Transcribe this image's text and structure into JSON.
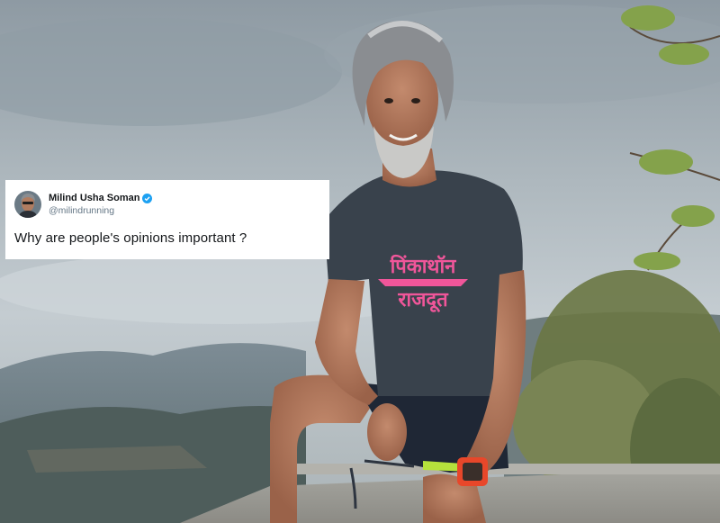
{
  "tweet": {
    "display_name": "Milind Usha Soman",
    "handle": "@milindrunning",
    "text": "Why are people's opinions important ?",
    "verified": true
  },
  "shirt_print": {
    "line1": "पिंकाथॉन",
    "line2": "राजदूत",
    "color": "#f0569a"
  },
  "watch_color": "#e8472a"
}
